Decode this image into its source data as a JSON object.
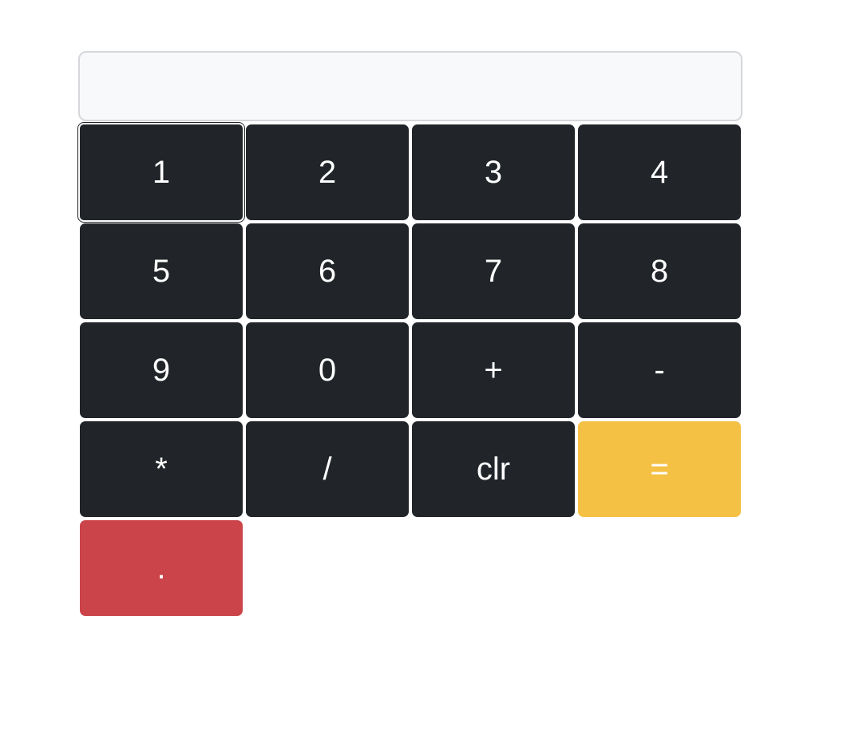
{
  "display": {
    "value": ""
  },
  "keys": [
    {
      "label": "1",
      "style": "dark"
    },
    {
      "label": "2",
      "style": "dark"
    },
    {
      "label": "3",
      "style": "dark"
    },
    {
      "label": "4",
      "style": "dark"
    },
    {
      "label": "5",
      "style": "dark"
    },
    {
      "label": "6",
      "style": "dark"
    },
    {
      "label": "7",
      "style": "dark"
    },
    {
      "label": "8",
      "style": "dark"
    },
    {
      "label": "9",
      "style": "dark"
    },
    {
      "label": "0",
      "style": "dark"
    },
    {
      "label": "+",
      "style": "dark"
    },
    {
      "label": "-",
      "style": "dark"
    },
    {
      "label": "*",
      "style": "dark"
    },
    {
      "label": "/",
      "style": "dark"
    },
    {
      "label": "clr",
      "style": "dark"
    },
    {
      "label": "=",
      "style": "warn"
    },
    {
      "label": ".",
      "style": "danger"
    }
  ],
  "colors": {
    "dark": "#212529",
    "warn": "#f4c145",
    "danger": "#cb444a",
    "display_bg": "#f8f9fa"
  }
}
